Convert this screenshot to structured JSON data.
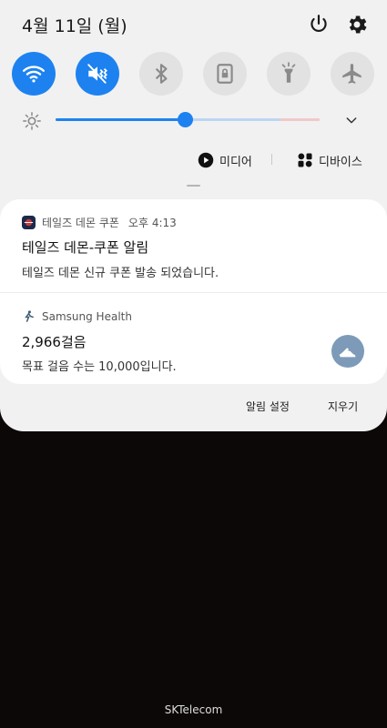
{
  "status": {
    "date": "4월 11일 (월)",
    "power_icon": "power-icon",
    "settings_icon": "gear-icon"
  },
  "quick_toggles": [
    {
      "name": "wifi",
      "icon": "wifi-icon",
      "on": true
    },
    {
      "name": "sound",
      "icon": "mute-vibrate-icon",
      "on": true
    },
    {
      "name": "bluetooth",
      "icon": "bluetooth-icon",
      "on": false
    },
    {
      "name": "rotation-lock",
      "icon": "lock-rotation-icon",
      "on": false
    },
    {
      "name": "flashlight",
      "icon": "flashlight-icon",
      "on": false
    },
    {
      "name": "airplane",
      "icon": "airplane-icon",
      "on": false
    }
  ],
  "brightness": {
    "level_percent": 49
  },
  "media": {
    "media_label": "미디어",
    "devices_label": "디바이스"
  },
  "notifications": [
    {
      "app": "테일즈 데몬 쿠폰",
      "time": "오후 4:13",
      "title": "테일즈 데몬-쿠폰 알림",
      "body": "테일즈 데몬 신규 쿠폰 발송 되었습니다."
    },
    {
      "app": "Samsung Health",
      "title": "2,966걸음",
      "body": "목표 걸음 수는 10,000입니다."
    }
  ],
  "actions": {
    "settings_label": "알림 설정",
    "clear_label": "지우기"
  },
  "carrier": "SKTelecom",
  "colors": {
    "accent": "#1d82f0",
    "panel_bg": "#f1f1f1",
    "card_bg": "#ffffff",
    "health_button": "#7d9bb8",
    "background": "#0d0808"
  }
}
